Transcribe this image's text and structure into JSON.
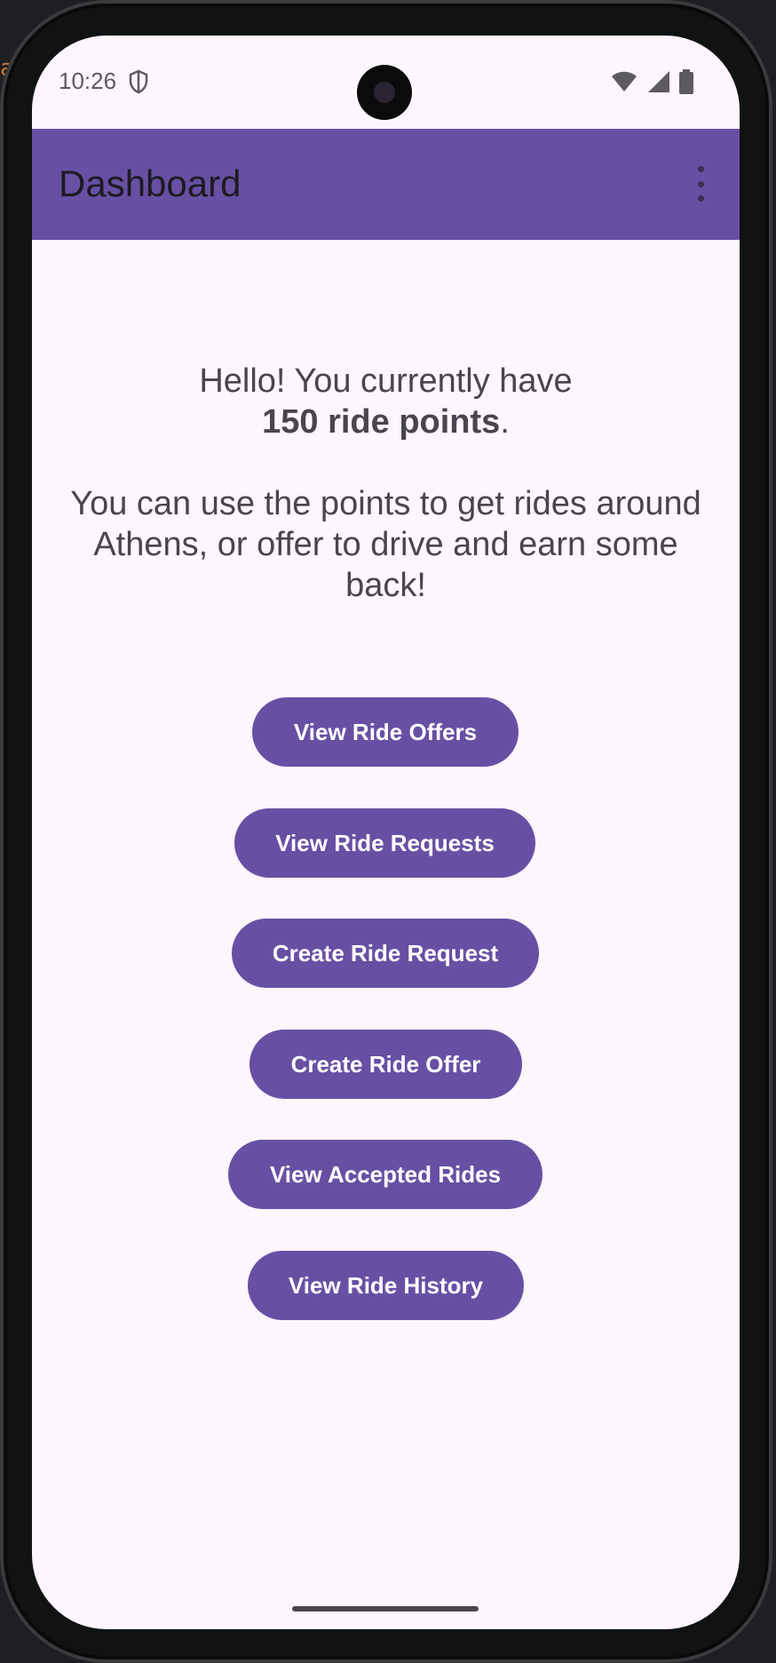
{
  "status_bar": {
    "time": "10:26"
  },
  "app_bar": {
    "title": "Dashboard"
  },
  "message": {
    "greeting": "Hello! You currently have",
    "points": "150 ride points",
    "points_suffix": ".",
    "body": "You can use the points to get rides around Athens, or offer to drive and earn some back!"
  },
  "buttons": [
    {
      "label": "View Ride Offers"
    },
    {
      "label": "View Ride Requests"
    },
    {
      "label": "Create Ride Request"
    },
    {
      "label": "Create Ride Offer"
    },
    {
      "label": "View Accepted Rides"
    },
    {
      "label": "View Ride History"
    }
  ],
  "colors": {
    "primary": "#6750a4",
    "background": "#fdf6fd",
    "text": "#49454f"
  }
}
